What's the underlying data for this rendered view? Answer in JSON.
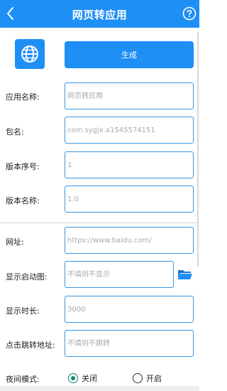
{
  "header": {
    "title": "网页转应用",
    "accent": "#1e8ff5"
  },
  "actions": {
    "generate_label": "生成"
  },
  "fields": {
    "app_name": {
      "label": "应用名称:",
      "placeholder": "网页转应用"
    },
    "package": {
      "label": "包名:",
      "placeholder": "com.sygjx.a1545574151"
    },
    "version_code": {
      "label": "版本序号:",
      "placeholder": "1"
    },
    "version_name": {
      "label": "版本名称:",
      "placeholder": "1.0"
    },
    "url": {
      "label": "网址:",
      "placeholder": "https://www.baidu.com/"
    },
    "splash": {
      "label": "显示启动图:",
      "placeholder": "不填则不显示"
    },
    "duration": {
      "label": "显示时长:",
      "placeholder": "3000"
    },
    "click_url": {
      "label": "点击跳转地址:",
      "placeholder": "不填则不跳转"
    }
  },
  "night_mode": {
    "label": "夜间模式:",
    "options": [
      {
        "label": "关闭",
        "selected": true
      },
      {
        "label": "开启",
        "selected": false
      }
    ],
    "selected_color": "#0c8a6f"
  },
  "icons": [
    "back-arrow-icon",
    "help-icon",
    "globe-icon",
    "folder-icon"
  ]
}
